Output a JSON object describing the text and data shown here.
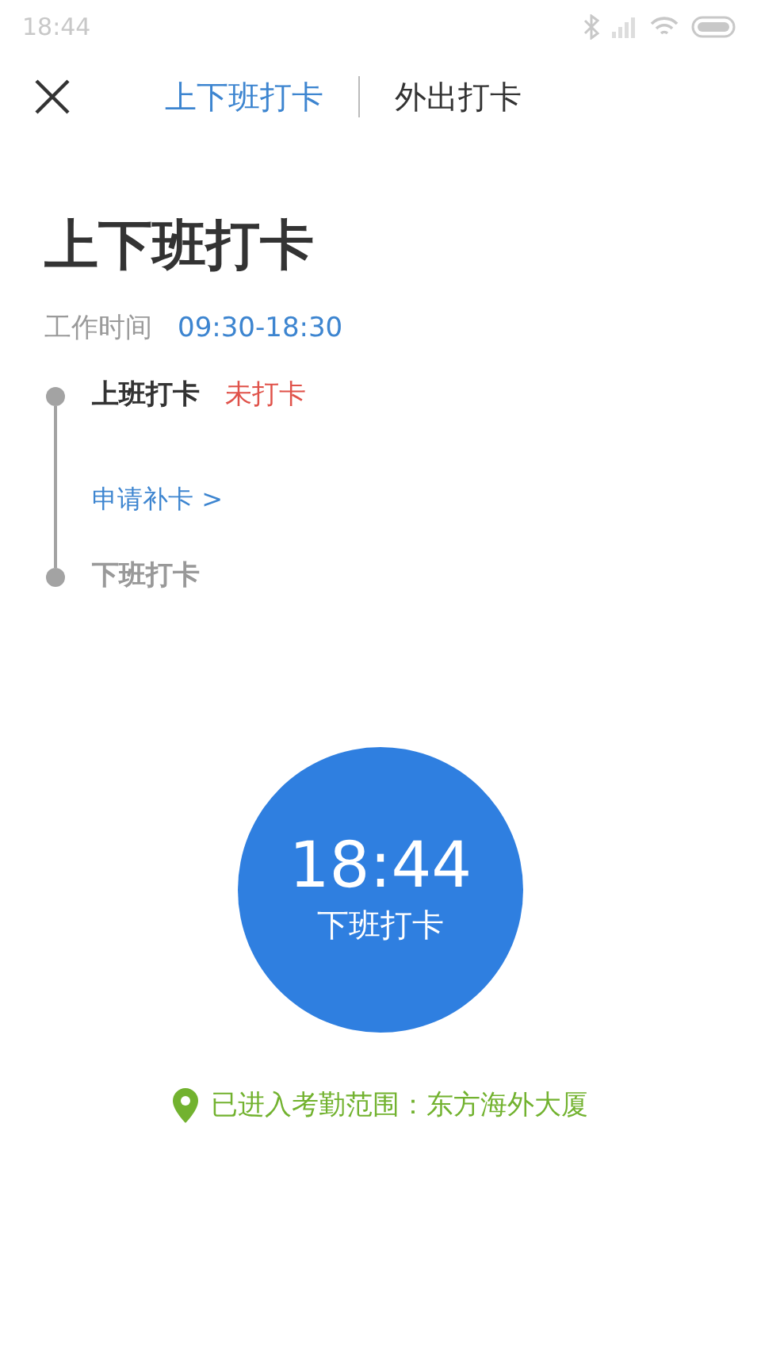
{
  "status_bar": {
    "time": "18:44"
  },
  "tabs": [
    {
      "label": "上下班打卡",
      "selected": true
    },
    {
      "label": "外出打卡",
      "selected": false
    }
  ],
  "title": "上下班打卡",
  "work_hours": {
    "label": "工作时间",
    "value": "09:30-18:30"
  },
  "records": [
    {
      "label": "上班打卡",
      "active": true,
      "status": "未打卡",
      "action": "申请补卡 >"
    },
    {
      "label": "下班打卡",
      "active": false
    }
  ],
  "punch_button": {
    "time": "18:44",
    "label": "下班打卡"
  },
  "location": "已进入考勤范围：东方海外大厦"
}
